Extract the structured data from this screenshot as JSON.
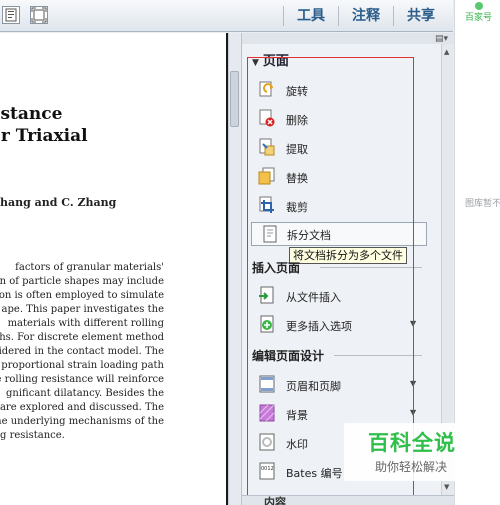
{
  "toolbar": {
    "icons": [
      "page-view-icon",
      "fit-page-icon"
    ],
    "buttons": [
      {
        "label": "工具"
      },
      {
        "label": "注释"
      },
      {
        "label": "共享"
      }
    ]
  },
  "document": {
    "title_lines": [
      "istance",
      "er Triaxial"
    ],
    "authors": "hang and C. Zhang",
    "body_lines": [
      "factors of granular materials'",
      "ion of particle shapes may include",
      "on is often employed to simulate",
      "ape. This paper investigates the",
      "materials with different rolling",
      "ths. For discrete element method",
      "idered in the contact model. The",
      "e proportional strain loading path",
      "he rolling resistance will reinforce",
      "gnificant dilatancy. Besides the",
      "are explored and discussed. The",
      "the underlying mechanisms of the",
      "g resistance."
    ]
  },
  "panel": {
    "section_pages": {
      "title": "页面",
      "items": [
        {
          "label": "旋转",
          "icon": "rotate-icon"
        },
        {
          "label": "删除",
          "icon": "delete-page-icon"
        },
        {
          "label": "提取",
          "icon": "extract-icon"
        },
        {
          "label": "替换",
          "icon": "replace-icon"
        },
        {
          "label": "裁剪",
          "icon": "crop-icon"
        },
        {
          "label": "拆分文档",
          "icon": "split-document-icon"
        }
      ]
    },
    "tooltip": "将文档拆分为多个文件",
    "section_insert": {
      "title": "插入页面",
      "items": [
        {
          "label": "从文件插入",
          "icon": "insert-from-file-icon"
        },
        {
          "label": "更多插入选项",
          "icon": "more-insert-icon"
        }
      ]
    },
    "section_design": {
      "title": "编辑页面设计",
      "items": [
        {
          "label": "页眉和页脚",
          "icon": "header-footer-icon"
        },
        {
          "label": "背景",
          "icon": "background-icon"
        },
        {
          "label": "水印",
          "icon": "watermark-icon"
        },
        {
          "label": "Bates 编号",
          "icon": "bates-number-icon"
        }
      ]
    },
    "bottom_section": "内容"
  },
  "site": {
    "top_text": "百家号",
    "mid_text": "图库暂不"
  },
  "watermark": {
    "main": "百科全说",
    "sub": "助你轻松解决"
  },
  "colors": {
    "accent_blue": "#2b5c8a",
    "highlight_red": "#e03030",
    "watermark_green": "#2fbf4a"
  }
}
